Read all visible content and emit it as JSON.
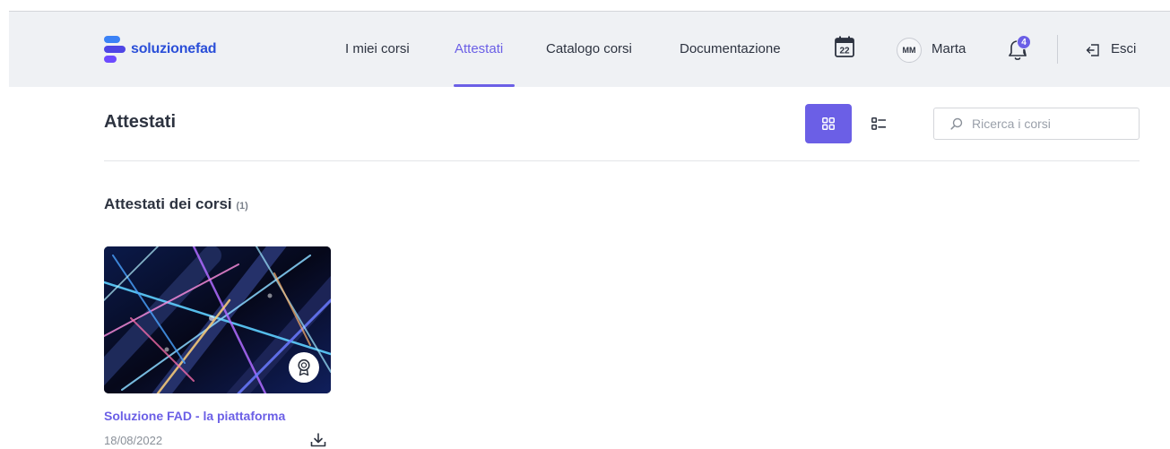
{
  "brand": {
    "name": "soluzionefad"
  },
  "nav": {
    "items": [
      {
        "label": "I miei corsi",
        "active": false
      },
      {
        "label": "Attestati",
        "active": true
      },
      {
        "label": "Catalogo corsi",
        "active": false
      },
      {
        "label": "Documentazione",
        "active": false
      }
    ],
    "calendar_day": "22",
    "user": {
      "initials": "MM",
      "name": "Marta"
    },
    "notifications_count": "4",
    "logout_label": "Esci"
  },
  "page": {
    "title": "Attestati",
    "view_mode": "grid",
    "search_placeholder": "Ricerca i corsi"
  },
  "section": {
    "title": "Attestati dei corsi",
    "count": "(1)"
  },
  "certificates": [
    {
      "title": "Soluzione FAD - la piattaforma",
      "date": "18/08/2022"
    }
  ],
  "colors": {
    "accent": "#6b5fe6",
    "brand_blue": "#2b4fd8",
    "navbar_bg": "#eff1f4",
    "text": "#2d3340"
  },
  "icons": {
    "calendar": "calendar-icon",
    "notifications": "bell-icon",
    "logout": "logout-icon",
    "view_grid": "grid-view-icon",
    "view_list": "list-view-icon",
    "search": "search-icon",
    "certificate": "award-icon",
    "download": "download-icon"
  }
}
